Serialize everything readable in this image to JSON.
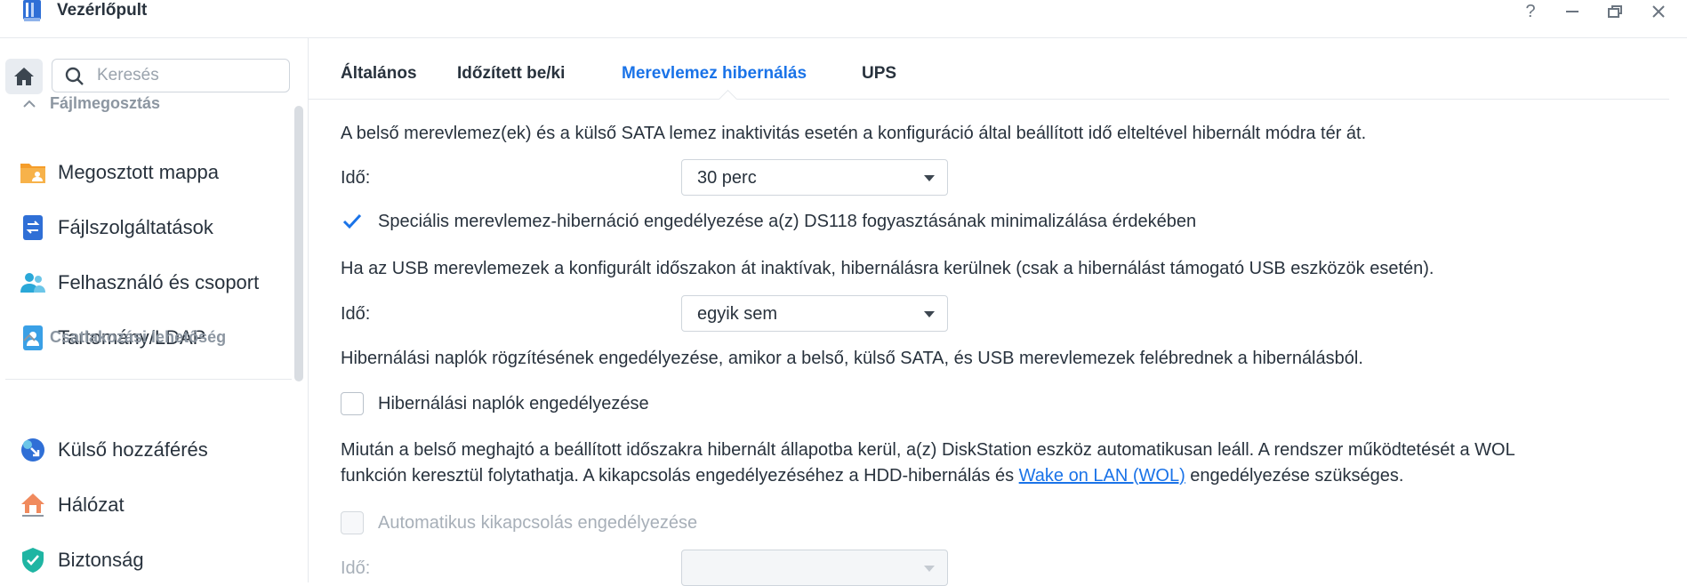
{
  "window": {
    "title": "Vezérlőpult",
    "controls": {
      "help": "?",
      "minimize": "—",
      "restore": "▭",
      "close": "✕"
    }
  },
  "sidebar": {
    "search_placeholder": "Keresés",
    "groups": [
      {
        "label": "Fájlmegosztás",
        "items": [
          {
            "label": "Megosztott mappa",
            "icon": "shared-folder-icon"
          },
          {
            "label": "Fájlszolgáltatások",
            "icon": "file-services-icon"
          },
          {
            "label": "Felhasználó és csoport",
            "icon": "users-icon"
          },
          {
            "label": "Tartomány/LDAP",
            "icon": "ldap-icon"
          }
        ]
      },
      {
        "label": "Csatlakozási lehetőség",
        "items": [
          {
            "label": "Külső hozzáférés",
            "icon": "external-access-icon"
          },
          {
            "label": "Hálózat",
            "icon": "network-icon"
          },
          {
            "label": "Biztonság",
            "icon": "shield-icon"
          }
        ]
      }
    ]
  },
  "tabs": [
    {
      "label": "Általános"
    },
    {
      "label": "Időzített be/ki"
    },
    {
      "label": "Merevlemez hibernálás",
      "active": true
    },
    {
      "label": "UPS"
    }
  ],
  "content": {
    "intro": "A belső merevlemez(ek) és a külső SATA lemez inaktivitás esetén a konfiguráció által beállított idő elteltével hibernált módra tér át.",
    "time_label": "Idő:",
    "internal_time_value": "30 perc",
    "special_hibernation_label": "Speciális merevlemez-hibernáció engedélyezése a(z) DS118 fogyasztásának minimalizálása érdekében",
    "special_hibernation_checked": true,
    "usb_text": "Ha az USB merevlemezek a konfigurált időszakon át inaktívak, hibernálásra kerülnek (csak a hibernálást támogató USB eszközök esetén).",
    "usb_time_value": "egyik sem",
    "log_text": "Hibernálási naplók rögzítésének engedélyezése, amikor a belső, külső SATA, és USB merevlemezek felébrednek a hibernálásból.",
    "log_checkbox_label": "Hibernálási naplók engedélyezése",
    "log_checked": false,
    "shutdown_text_1": "Miután a belső meghajtó a beállított időszakra hibernált állapotba kerül, a(z) DiskStation eszköz automatikusan leáll. A rendszer működtetését a WOL",
    "shutdown_text_2a": "funkción keresztül folytathatja. A kikapcsolás engedélyezéséhez a HDD-hibernálás és ",
    "shutdown_link": "Wake on LAN (WOL)",
    "shutdown_text_2b": " engedélyezése szükséges.",
    "auto_shutdown_label": "Automatikus kikapcsolás engedélyezése",
    "auto_shutdown_checked": false
  },
  "colors": {
    "accent": "#1a73e8",
    "text": "#28323d",
    "muted": "#8c96a1"
  }
}
